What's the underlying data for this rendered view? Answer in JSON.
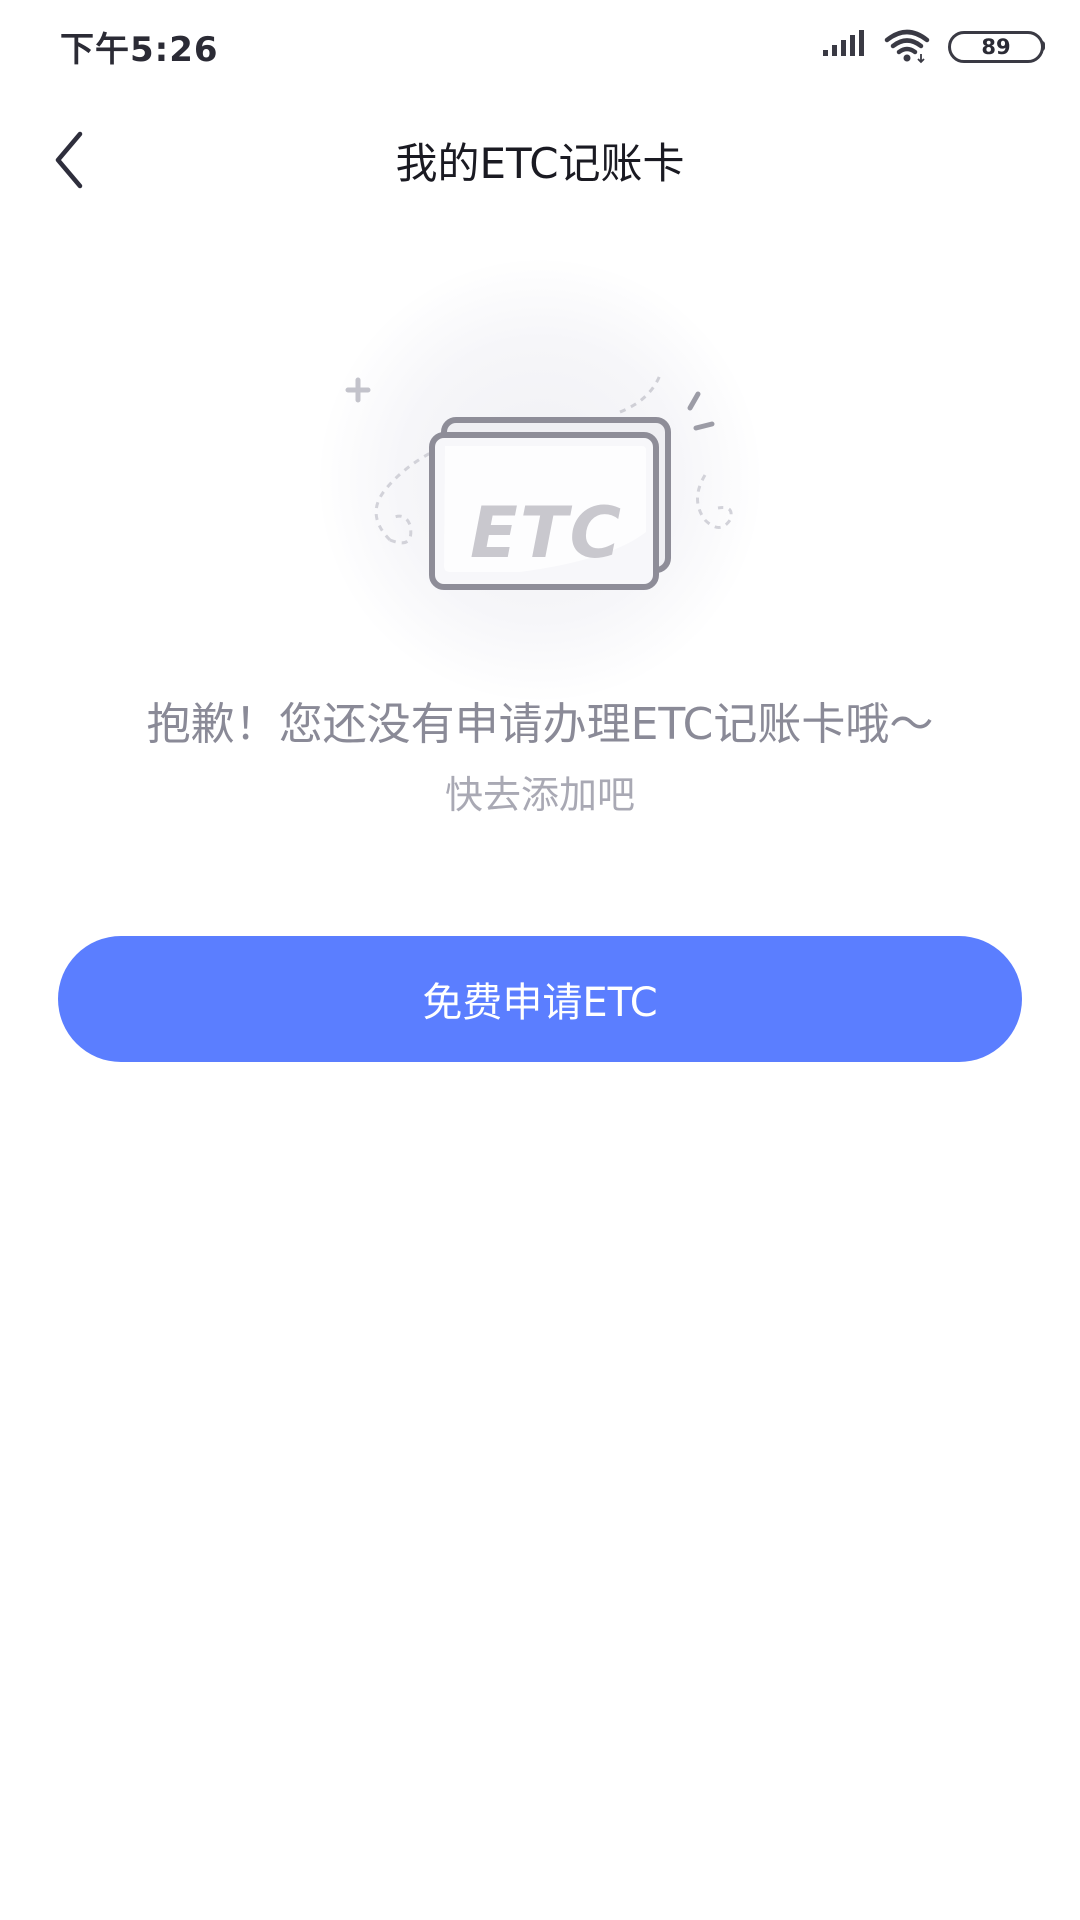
{
  "status_bar": {
    "time": "下午5:26",
    "battery": "89",
    "icons": [
      "signal-icon",
      "wifi-icon",
      "battery-icon"
    ]
  },
  "nav": {
    "title": "我的ETC记账卡",
    "back_icon": "chevron-left-icon"
  },
  "empty_state": {
    "illustration_icon": "etc-card-icon",
    "illustration_label": "ETC",
    "message": "抱歉！您还没有申请办理ETC记账卡哦～",
    "hint": "快去添加吧"
  },
  "actions": {
    "apply_label": "免费申请ETC"
  },
  "colors": {
    "accent": "#5b7eff",
    "message_text": "#8a8a97",
    "hint_text": "#a9a9b4"
  }
}
